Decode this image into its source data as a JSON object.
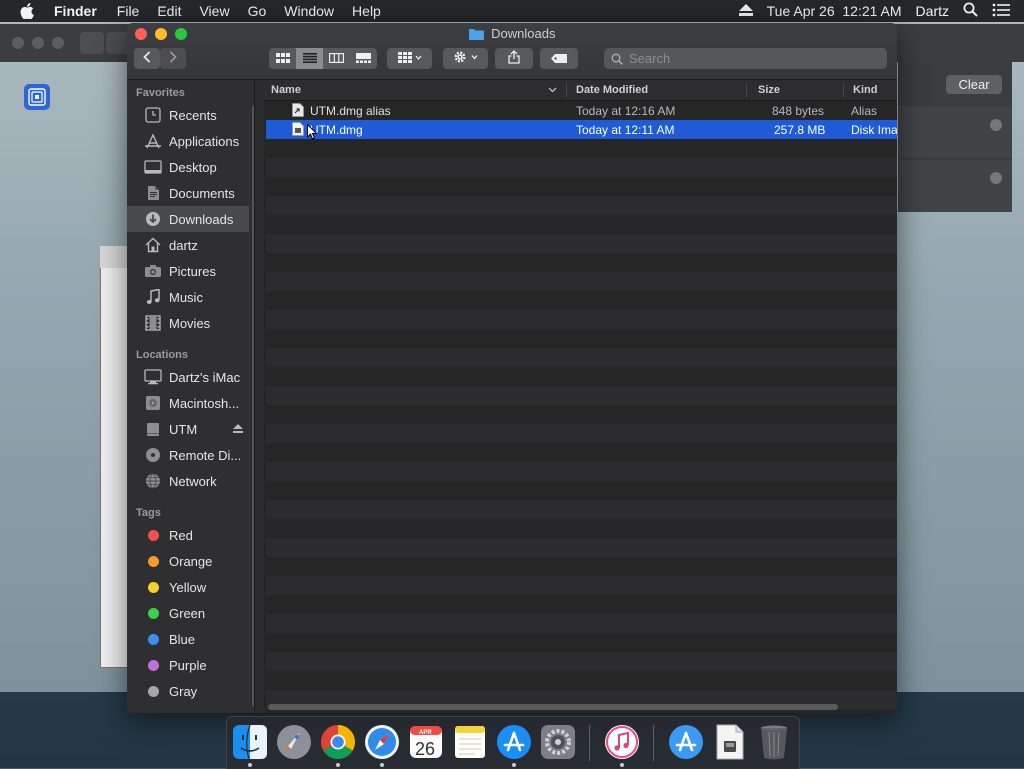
{
  "menubar": {
    "app_name": "Finder",
    "items": [
      "File",
      "Edit",
      "View",
      "Go",
      "Window",
      "Help"
    ],
    "clock": "Tue Apr 26  12:21 AM",
    "user": "Dartz"
  },
  "background": {
    "clear_label": "Clear"
  },
  "window": {
    "title": "Downloads",
    "search_placeholder": "Search"
  },
  "sidebar": {
    "favorites_header": "Favorites",
    "favorites": [
      {
        "label": "Recents",
        "icon": "clock-icon"
      },
      {
        "label": "Applications",
        "icon": "applications-icon"
      },
      {
        "label": "Desktop",
        "icon": "desktop-icon"
      },
      {
        "label": "Documents",
        "icon": "documents-icon"
      },
      {
        "label": "Downloads",
        "icon": "downloads-icon",
        "selected": true
      },
      {
        "label": "dartz",
        "icon": "home-icon"
      },
      {
        "label": "Pictures",
        "icon": "camera-icon"
      },
      {
        "label": "Music",
        "icon": "music-note-icon"
      },
      {
        "label": "Movies",
        "icon": "film-icon"
      }
    ],
    "locations_header": "Locations",
    "locations": [
      {
        "label": "Dartz's iMac",
        "icon": "imac-icon"
      },
      {
        "label": "Macintosh...",
        "icon": "hard-drive-icon"
      },
      {
        "label": "UTM",
        "icon": "disk-icon"
      },
      {
        "label": "Remote Di...",
        "icon": "optical-disc-icon"
      },
      {
        "label": "Network",
        "icon": "globe-icon"
      }
    ],
    "tags_header": "Tags",
    "tags": [
      {
        "label": "Red",
        "color": "#f0514c"
      },
      {
        "label": "Orange",
        "color": "#f59a2e"
      },
      {
        "label": "Yellow",
        "color": "#f2d32c"
      },
      {
        "label": "Green",
        "color": "#3fcf4f"
      },
      {
        "label": "Blue",
        "color": "#3a8ff6"
      },
      {
        "label": "Purple",
        "color": "#c46ce0"
      },
      {
        "label": "Gray",
        "color": "#a6a6aa"
      }
    ]
  },
  "list": {
    "columns": [
      "Name",
      "Date Modified",
      "Size",
      "Kind"
    ],
    "rows": [
      {
        "name": "UTM.dmg alias",
        "date": "Today at 12:16 AM",
        "size": "848 bytes",
        "kind": "Alias",
        "selected": false
      },
      {
        "name": "UTM.dmg",
        "date": "Today at 12:11 AM",
        "size": "257.8 MB",
        "kind": "Disk Ima",
        "selected": true
      }
    ]
  },
  "dock": {
    "calendar_month": "APR",
    "calendar_day": "26",
    "apps": [
      "finder-icon",
      "launchpad-icon",
      "chrome-icon",
      "safari-icon",
      "calendar-icon",
      "notes-icon",
      "app-store-icon",
      "system-preferences-icon",
      "itunes-icon",
      "applications-folder-icon",
      "document-icon",
      "trash-icon"
    ]
  },
  "colors": {
    "selection": "#1f5ad7",
    "close": "#fc5f57",
    "minimize": "#fdbc2e",
    "maximize": "#28c840"
  }
}
